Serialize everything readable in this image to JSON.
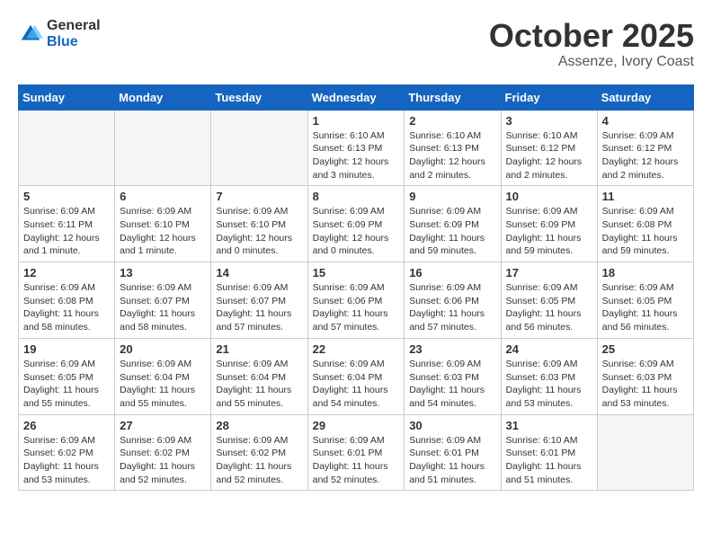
{
  "header": {
    "logo_general": "General",
    "logo_blue": "Blue",
    "month": "October 2025",
    "location": "Assenze, Ivory Coast"
  },
  "weekdays": [
    "Sunday",
    "Monday",
    "Tuesday",
    "Wednesday",
    "Thursday",
    "Friday",
    "Saturday"
  ],
  "weeks": [
    [
      {
        "day": "",
        "info": ""
      },
      {
        "day": "",
        "info": ""
      },
      {
        "day": "",
        "info": ""
      },
      {
        "day": "1",
        "info": "Sunrise: 6:10 AM\nSunset: 6:13 PM\nDaylight: 12 hours and 3 minutes."
      },
      {
        "day": "2",
        "info": "Sunrise: 6:10 AM\nSunset: 6:13 PM\nDaylight: 12 hours and 2 minutes."
      },
      {
        "day": "3",
        "info": "Sunrise: 6:10 AM\nSunset: 6:12 PM\nDaylight: 12 hours and 2 minutes."
      },
      {
        "day": "4",
        "info": "Sunrise: 6:09 AM\nSunset: 6:12 PM\nDaylight: 12 hours and 2 minutes."
      }
    ],
    [
      {
        "day": "5",
        "info": "Sunrise: 6:09 AM\nSunset: 6:11 PM\nDaylight: 12 hours and 1 minute."
      },
      {
        "day": "6",
        "info": "Sunrise: 6:09 AM\nSunset: 6:10 PM\nDaylight: 12 hours and 1 minute."
      },
      {
        "day": "7",
        "info": "Sunrise: 6:09 AM\nSunset: 6:10 PM\nDaylight: 12 hours and 0 minutes."
      },
      {
        "day": "8",
        "info": "Sunrise: 6:09 AM\nSunset: 6:09 PM\nDaylight: 12 hours and 0 minutes."
      },
      {
        "day": "9",
        "info": "Sunrise: 6:09 AM\nSunset: 6:09 PM\nDaylight: 11 hours and 59 minutes."
      },
      {
        "day": "10",
        "info": "Sunrise: 6:09 AM\nSunset: 6:09 PM\nDaylight: 11 hours and 59 minutes."
      },
      {
        "day": "11",
        "info": "Sunrise: 6:09 AM\nSunset: 6:08 PM\nDaylight: 11 hours and 59 minutes."
      }
    ],
    [
      {
        "day": "12",
        "info": "Sunrise: 6:09 AM\nSunset: 6:08 PM\nDaylight: 11 hours and 58 minutes."
      },
      {
        "day": "13",
        "info": "Sunrise: 6:09 AM\nSunset: 6:07 PM\nDaylight: 11 hours and 58 minutes."
      },
      {
        "day": "14",
        "info": "Sunrise: 6:09 AM\nSunset: 6:07 PM\nDaylight: 11 hours and 57 minutes."
      },
      {
        "day": "15",
        "info": "Sunrise: 6:09 AM\nSunset: 6:06 PM\nDaylight: 11 hours and 57 minutes."
      },
      {
        "day": "16",
        "info": "Sunrise: 6:09 AM\nSunset: 6:06 PM\nDaylight: 11 hours and 57 minutes."
      },
      {
        "day": "17",
        "info": "Sunrise: 6:09 AM\nSunset: 6:05 PM\nDaylight: 11 hours and 56 minutes."
      },
      {
        "day": "18",
        "info": "Sunrise: 6:09 AM\nSunset: 6:05 PM\nDaylight: 11 hours and 56 minutes."
      }
    ],
    [
      {
        "day": "19",
        "info": "Sunrise: 6:09 AM\nSunset: 6:05 PM\nDaylight: 11 hours and 55 minutes."
      },
      {
        "day": "20",
        "info": "Sunrise: 6:09 AM\nSunset: 6:04 PM\nDaylight: 11 hours and 55 minutes."
      },
      {
        "day": "21",
        "info": "Sunrise: 6:09 AM\nSunset: 6:04 PM\nDaylight: 11 hours and 55 minutes."
      },
      {
        "day": "22",
        "info": "Sunrise: 6:09 AM\nSunset: 6:04 PM\nDaylight: 11 hours and 54 minutes."
      },
      {
        "day": "23",
        "info": "Sunrise: 6:09 AM\nSunset: 6:03 PM\nDaylight: 11 hours and 54 minutes."
      },
      {
        "day": "24",
        "info": "Sunrise: 6:09 AM\nSunset: 6:03 PM\nDaylight: 11 hours and 53 minutes."
      },
      {
        "day": "25",
        "info": "Sunrise: 6:09 AM\nSunset: 6:03 PM\nDaylight: 11 hours and 53 minutes."
      }
    ],
    [
      {
        "day": "26",
        "info": "Sunrise: 6:09 AM\nSunset: 6:02 PM\nDaylight: 11 hours and 53 minutes."
      },
      {
        "day": "27",
        "info": "Sunrise: 6:09 AM\nSunset: 6:02 PM\nDaylight: 11 hours and 52 minutes."
      },
      {
        "day": "28",
        "info": "Sunrise: 6:09 AM\nSunset: 6:02 PM\nDaylight: 11 hours and 52 minutes."
      },
      {
        "day": "29",
        "info": "Sunrise: 6:09 AM\nSunset: 6:01 PM\nDaylight: 11 hours and 52 minutes."
      },
      {
        "day": "30",
        "info": "Sunrise: 6:09 AM\nSunset: 6:01 PM\nDaylight: 11 hours and 51 minutes."
      },
      {
        "day": "31",
        "info": "Sunrise: 6:10 AM\nSunset: 6:01 PM\nDaylight: 11 hours and 51 minutes."
      },
      {
        "day": "",
        "info": ""
      }
    ]
  ]
}
